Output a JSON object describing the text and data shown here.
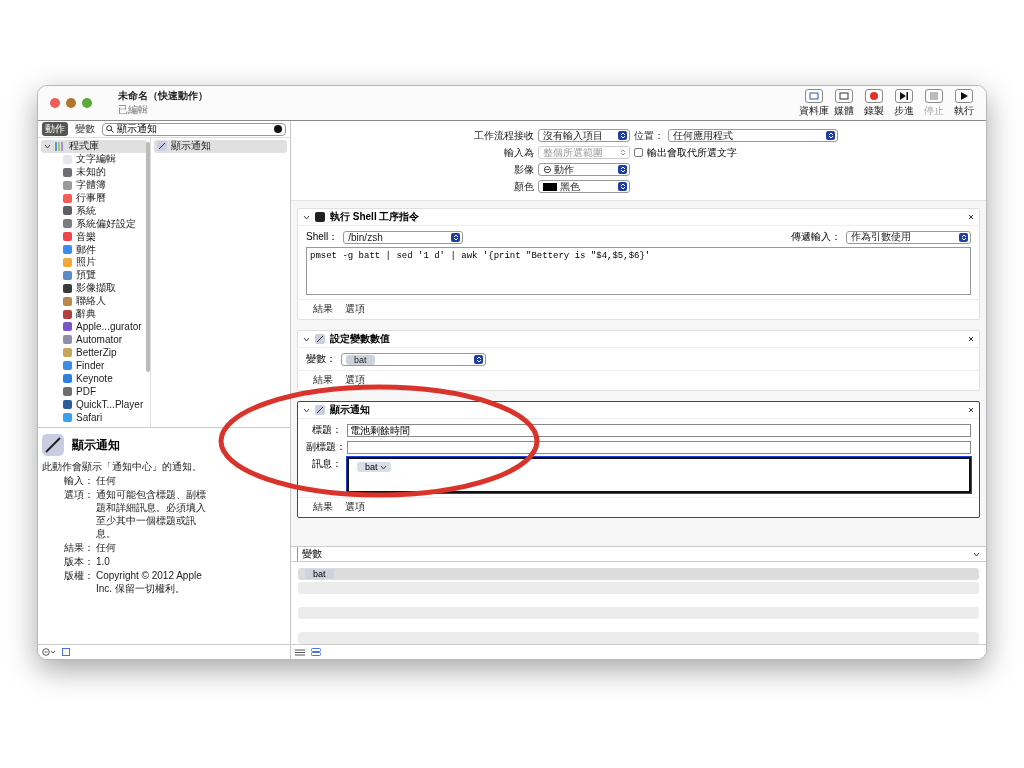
{
  "window": {
    "title": "未命名（快速動作）",
    "subtitle": "已編輯"
  },
  "toolbar": [
    {
      "label": "資料庫",
      "kind": "library",
      "disabled": false
    },
    {
      "label": "媒體",
      "kind": "media",
      "disabled": false
    },
    {
      "label": "錄製",
      "kind": "record",
      "disabled": false
    },
    {
      "label": "步進",
      "kind": "step",
      "disabled": false
    },
    {
      "label": "停止",
      "kind": "stop",
      "disabled": true
    },
    {
      "label": "執行",
      "kind": "run",
      "disabled": false
    }
  ],
  "left_tabs": [
    {
      "label": "動作",
      "selected": true
    },
    {
      "label": "變數",
      "selected": false
    }
  ],
  "search": {
    "value": "顯示通知"
  },
  "library": {
    "label": "程式庫",
    "expanded": true,
    "selected": true,
    "children": [
      {
        "label": "文字編輯",
        "color": "#e8e4f0"
      },
      {
        "label": "未知的",
        "color": "#6d6d72"
      },
      {
        "label": "字體簿",
        "color": "#9a9a9a"
      },
      {
        "label": "行事曆",
        "color": "#f25c54"
      },
      {
        "label": "系統",
        "color": "#5e5e62"
      },
      {
        "label": "系統偏好設定",
        "color": "#7d7d80"
      },
      {
        "label": "音樂",
        "color": "#f0444f"
      },
      {
        "label": "郵件",
        "color": "#3d8bf0"
      },
      {
        "label": "照片",
        "color": "#f3a73b"
      },
      {
        "label": "預覽",
        "color": "#5d8ac7"
      },
      {
        "label": "影像擷取",
        "color": "#3a3a3c"
      },
      {
        "label": "聯絡人",
        "color": "#b88a4a"
      },
      {
        "label": "辭典",
        "color": "#b0413e"
      },
      {
        "label": "Apple...gurator",
        "color": "#7a55c9"
      },
      {
        "label": "Automator",
        "color": "#8e8ea8"
      },
      {
        "label": "BetterZip",
        "color": "#c9a55a"
      },
      {
        "label": "Finder",
        "color": "#3a8ee6"
      },
      {
        "label": "Keynote",
        "color": "#2f7fe0"
      },
      {
        "label": "PDF",
        "color": "#6d6d72"
      },
      {
        "label": "QuickT...Player",
        "color": "#2d5c9a"
      },
      {
        "label": "Safari",
        "color": "#3aa0f0"
      }
    ]
  },
  "actions_list": [
    {
      "label": "顯示通知",
      "selected": true
    }
  ],
  "description": {
    "title": "顯示通知",
    "summary": "此動作會顯示「通知中心」的通知。",
    "details": [
      {
        "key": "輸入：",
        "value": "任何"
      },
      {
        "key": "選項：",
        "value": "通知可能包含標題、副標題和詳細訊息。必須填入至少其中一個標題或訊息。"
      },
      {
        "key": "結果：",
        "value": "任何"
      },
      {
        "key": "版本：",
        "value": "1.0"
      },
      {
        "key": "版權：",
        "value": "Copyright © 2012 Apple Inc. 保留一切權利。"
      }
    ]
  },
  "workflow_settings": {
    "receives": {
      "label": "工作流程接收",
      "value": "沒有輸入項目"
    },
    "location": {
      "label": "位置：",
      "value": "任何應用程式"
    },
    "input_is": {
      "label": "輸入為",
      "value": "整個所選範圍",
      "disabled": true
    },
    "replace": {
      "label": "輸出會取代所選文字",
      "checked": false
    },
    "image": {
      "label": "影像",
      "value": "⊖ 動作"
    },
    "color": {
      "label": "顏色",
      "value": "黑色",
      "color": "#000000"
    }
  },
  "actions": [
    {
      "kind": "shell",
      "title": "執行 Shell 工序指令",
      "selected": false,
      "shell_label": "Shell：",
      "shell": "/bin/zsh",
      "pass_label": "傳遞輸入：",
      "pass": "作為引數使用",
      "script": "pmset -g batt | sed '1 d' | awk '{print \"Bettery is \"$4,$5,$6}'",
      "footer": [
        "結果",
        "選項"
      ]
    },
    {
      "kind": "set_variable",
      "title": "設定變數數值",
      "selected": false,
      "variable_label": "變數：",
      "variable": "bat",
      "footer": [
        "結果",
        "選項"
      ]
    },
    {
      "kind": "notification",
      "title": "顯示通知",
      "selected": true,
      "fields": [
        {
          "label": "標題：",
          "value": "電池剩餘時間"
        },
        {
          "label": "副標題："
        }
      ],
      "message_label": "訊息：",
      "message_token": "bat",
      "footer": [
        "結果",
        "選項"
      ]
    }
  ],
  "variables_panel": {
    "header": "變數",
    "rows": [
      {
        "name": "bat",
        "selected": true
      }
    ]
  }
}
